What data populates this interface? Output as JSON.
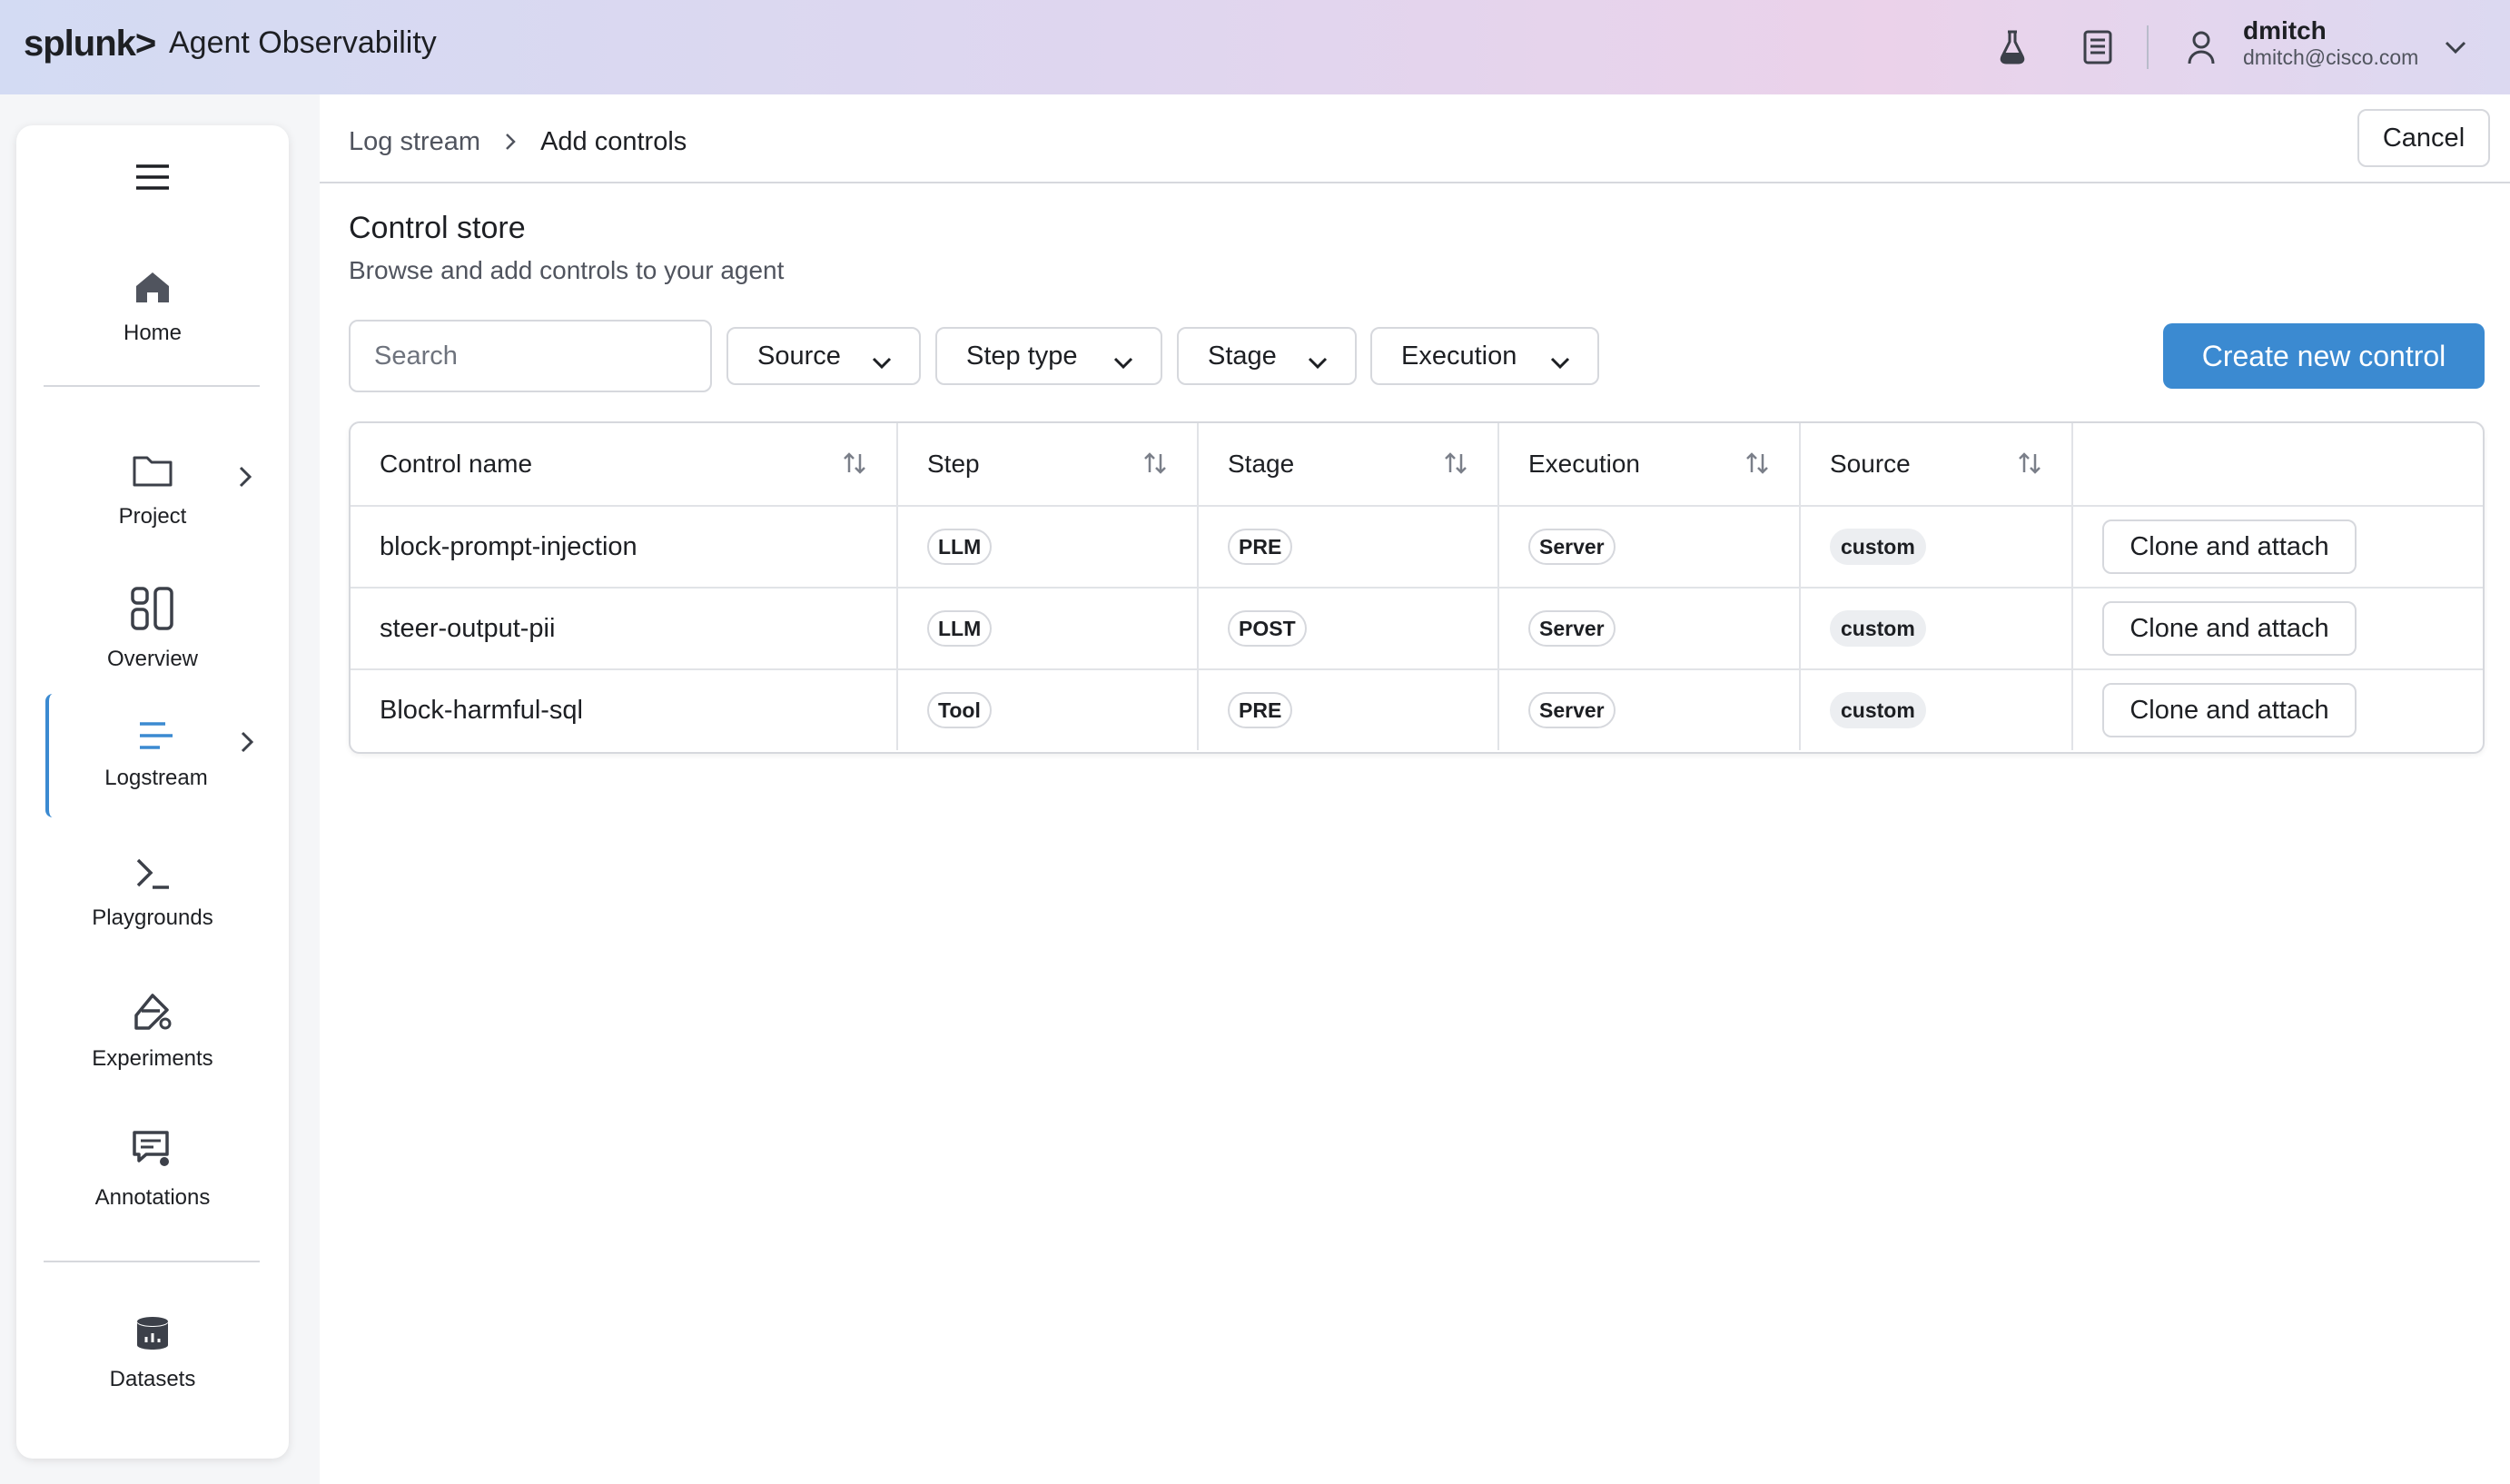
{
  "header": {
    "logo": "splunk>",
    "app_title": "Agent Observability",
    "user_name": "dmitch",
    "user_email": "dmitch@cisco.com",
    "icons": [
      "flask-icon",
      "document-icon",
      "user-icon",
      "chevron-down-icon"
    ]
  },
  "sidebar": {
    "items": [
      {
        "label": "Home",
        "icon": "home-icon"
      },
      {
        "label": "Project",
        "icon": "folder-icon"
      },
      {
        "label": "Overview",
        "icon": "overview-icon"
      },
      {
        "label": "Logstream",
        "icon": "logstream-icon",
        "active": true
      },
      {
        "label": "Playgrounds",
        "icon": "terminal-icon"
      },
      {
        "label": "Experiments",
        "icon": "experiment-icon"
      },
      {
        "label": "Annotations",
        "icon": "annotation-icon"
      },
      {
        "label": "Datasets",
        "icon": "database-icon"
      }
    ]
  },
  "breadcrumb": {
    "parent": "Log stream",
    "current": "Add controls"
  },
  "actions": {
    "cancel_label": "Cancel",
    "create_label": "Create new control"
  },
  "store": {
    "title": "Control store",
    "subtitle": "Browse and add controls to your agent"
  },
  "search": {
    "placeholder": "Search",
    "value": ""
  },
  "filters": {
    "source": "Source",
    "step_type": "Step type",
    "stage": "Stage",
    "execution": "Execution"
  },
  "table": {
    "columns": [
      "Control name",
      "Step",
      "Stage",
      "Execution",
      "Source"
    ],
    "rows": [
      {
        "name": "block-prompt-injection",
        "step": "LLM",
        "stage": "PRE",
        "execution": "Server",
        "source": "custom",
        "action": "Clone and attach"
      },
      {
        "name": "steer-output-pii",
        "step": "LLM",
        "stage": "POST",
        "execution": "Server",
        "source": "custom",
        "action": "Clone and attach"
      },
      {
        "name": "Block-harmful-sql",
        "step": "Tool",
        "stage": "PRE",
        "execution": "Server",
        "source": "custom",
        "action": "Clone and attach"
      }
    ]
  },
  "colors": {
    "accent": "#3b8ad1",
    "text": "#1d1f23",
    "muted": "#50545e",
    "border": "#d6d8dd"
  }
}
